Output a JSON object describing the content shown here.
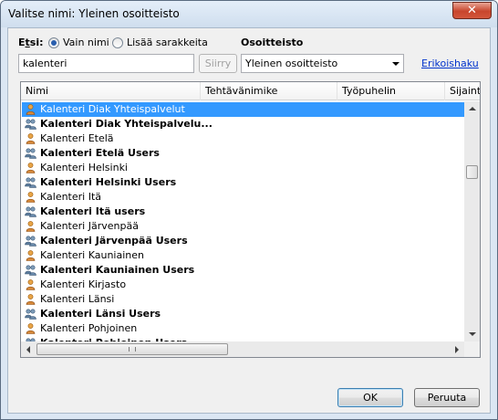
{
  "window": {
    "title": "Valitse nimi: Yleinen osoitteisto",
    "close_icon": "close-icon"
  },
  "search": {
    "label_prefix": "E",
    "label_mnemonic": "t",
    "label_suffix": "si:",
    "option_names_only": "Vain nimi",
    "option_more_columns": "Lisää sarakkeita",
    "selected_option": "Vain nimi",
    "value": "kalenteri",
    "go_button": "Siirry"
  },
  "address_book": {
    "label": "Osoitteisto",
    "selected": "Yleinen osoitteisto",
    "advanced_link": "Erikoishaku"
  },
  "list": {
    "columns": [
      "Nimi",
      "Tehtävänimike",
      "Työpuhelin",
      "Sijainti"
    ],
    "rows": [
      {
        "name": "Kalenteri Diak Yhteispalvelut",
        "type": "user",
        "selected": true
      },
      {
        "name": "Kalenteri Diak Yhteispalvelu...",
        "type": "group"
      },
      {
        "name": "Kalenteri Etelä",
        "type": "user"
      },
      {
        "name": "Kalenteri Etelä Users",
        "type": "group"
      },
      {
        "name": "Kalenteri Helsinki",
        "type": "user"
      },
      {
        "name": "Kalenteri Helsinki Users",
        "type": "group"
      },
      {
        "name": "Kalenteri Itä",
        "type": "user"
      },
      {
        "name": "Kalenteri Itä users",
        "type": "group"
      },
      {
        "name": "Kalenteri Järvenpää",
        "type": "user"
      },
      {
        "name": "Kalenteri Järvenpää Users",
        "type": "group"
      },
      {
        "name": "Kalenteri Kauniainen",
        "type": "user"
      },
      {
        "name": "Kalenteri Kauniainen Users",
        "type": "group"
      },
      {
        "name": "Kalenteri Kirjasto",
        "type": "user"
      },
      {
        "name": "Kalenteri Länsi",
        "type": "user"
      },
      {
        "name": "Kalenteri Länsi Users",
        "type": "group"
      },
      {
        "name": "Kalenteri Pohjoinen",
        "type": "user"
      },
      {
        "name": "Kalenteri Pohjoinen Users",
        "type": "group"
      }
    ]
  },
  "buttons": {
    "ok": "OK",
    "cancel": "Peruuta"
  },
  "colors": {
    "selection": "#3399ff",
    "link": "#0033cc",
    "close": "#c8452c"
  }
}
